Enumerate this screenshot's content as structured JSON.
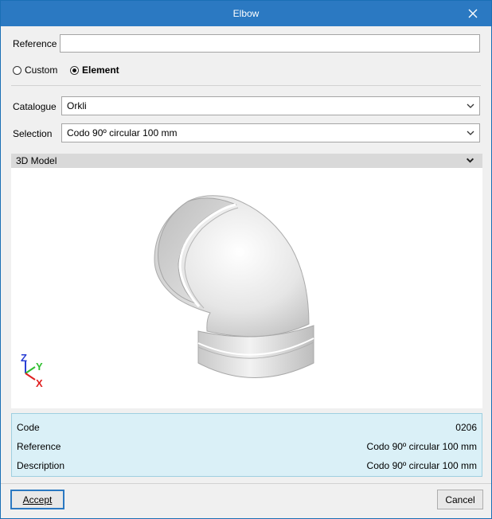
{
  "window": {
    "title": "Elbow"
  },
  "form": {
    "reference_label": "Reference",
    "reference_value": "",
    "mode_options": [
      "Custom",
      "Element"
    ],
    "mode_selected": "Element",
    "catalogue_label": "Catalogue",
    "catalogue_value": "Orkli",
    "selection_label": "Selection",
    "selection_value": "Codo 90º circular 100 mm"
  },
  "model_section": {
    "title": "3D Model"
  },
  "axes": {
    "z": "Z",
    "y": "Y",
    "x": "X"
  },
  "info": {
    "rows": [
      {
        "key": "Code",
        "value": "0206"
      },
      {
        "key": "Reference",
        "value": "Codo 90º circular 100 mm"
      },
      {
        "key": "Description",
        "value": "Codo 90º circular 100 mm"
      }
    ]
  },
  "buttons": {
    "accept": "Accept",
    "cancel": "Cancel"
  },
  "colors": {
    "titlebar": "#2b79c2",
    "info_panel": "#daf0f7",
    "axis_z": "#2a3fd4",
    "axis_y": "#2fbf2f",
    "axis_x": "#e02020"
  },
  "icons": {
    "close": "close-icon",
    "dropdown": "chevron-down-icon"
  }
}
